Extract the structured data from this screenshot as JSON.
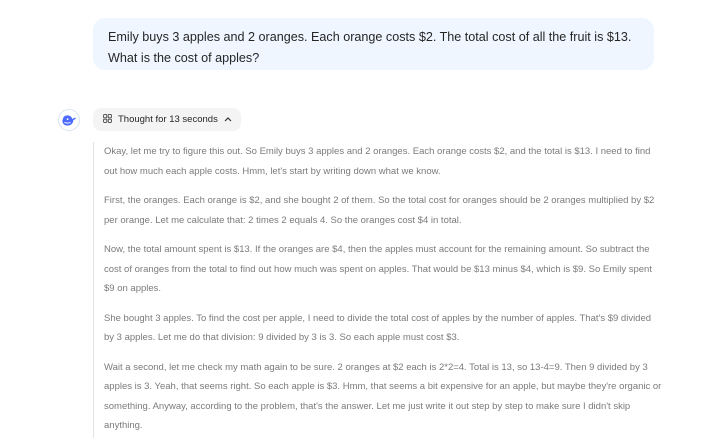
{
  "user_message": "Emily buys 3 apples and 2 oranges. Each orange costs $2. The total cost of all the fruit is $13. What is the cost of apples?",
  "assistant": {
    "avatar_icon": "whale-logo-icon",
    "thought_toggle_label": "Thought for 13 seconds",
    "reasoning_paragraphs": [
      "Okay, let me try to figure this out. So Emily buys 3 apples and 2 oranges. Each orange costs $2, and the total is $13. I need to find out how much each apple costs. Hmm, let's start by writing down what we know.",
      "First, the oranges. Each orange is $2, and she bought 2 of them. So the total cost for oranges should be 2 oranges multiplied by $2 per orange. Let me calculate that: 2 times 2 equals 4. So the oranges cost $4 in total.",
      "Now, the total amount spent is $13. If the oranges are $4, then the apples must account for the remaining amount. So subtract the cost of oranges from the total to find out how much was spent on apples. That would be $13 minus $4, which is $9. So Emily spent $9 on apples.",
      "She bought 3 apples. To find the cost per apple, I need to divide the total cost of apples by the number of apples. That's $9 divided by 3 apples. Let me do that division: 9 divided by 3 is 3. So each apple must cost $3.",
      "Wait a second, let me check my math again to be sure. 2 oranges at $2 each is 2*2=4. Total is 13, so 13-4=9. Then 9 divided by 3 apples is 3. Yeah, that seems right. So each apple is $3. Hmm, that seems a bit expensive for an apple, but maybe they're organic or something. Anyway, according to the problem, that's the answer. Let me just write it out step by step to make sure I didn't skip anything."
    ]
  }
}
